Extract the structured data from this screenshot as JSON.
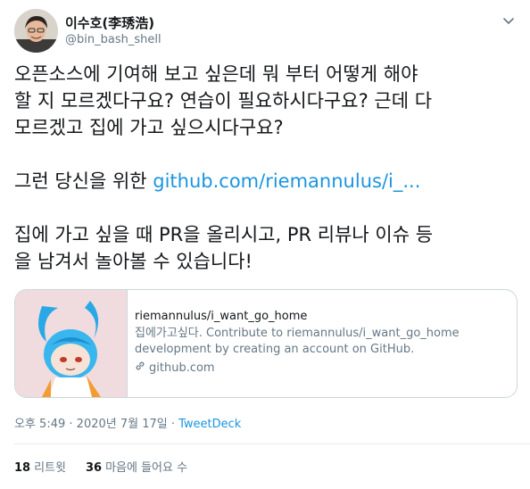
{
  "author": {
    "display_name": "이수호(李琇浩)",
    "handle": "@bin_bash_shell"
  },
  "tweet": {
    "line1": "오픈소스에 기여해 보고 싶은데 뭐 부터 어떻게 해야",
    "line2": "할 지 모르겠다구요? 연습이 필요하시다구요? 근데 다",
    "line3": "모르겠고 집에 가고 싶으시다구요?",
    "line4_prefix": "그런 당신을 위한 ",
    "line4_link": "github.com/riemannulus/i_...",
    "line5": "집에 가고 싶을 때 PR을 올리시고, PR 리뷰나 이슈 등",
    "line6": "을 남겨서 놀아볼 수 있습니다!"
  },
  "card": {
    "title": "riemannulus/i_want_go_home",
    "description": "집에가고싶다. Contribute to riemannulus/i_want_go_home development by creating an account on GitHub.",
    "domain": "github.com"
  },
  "meta": {
    "time": "오후 5:49",
    "separator1": "·",
    "date": "2020년 7월 17일",
    "separator2": "·",
    "source": "TweetDeck"
  },
  "stats": {
    "retweets_count": "18",
    "retweets_label": "리트윗",
    "likes_count": "36",
    "likes_label": "마음에 들어요 수"
  },
  "colors": {
    "link": "#1b95e0",
    "secondary_text": "#657786",
    "border": "#ccd6dd"
  }
}
